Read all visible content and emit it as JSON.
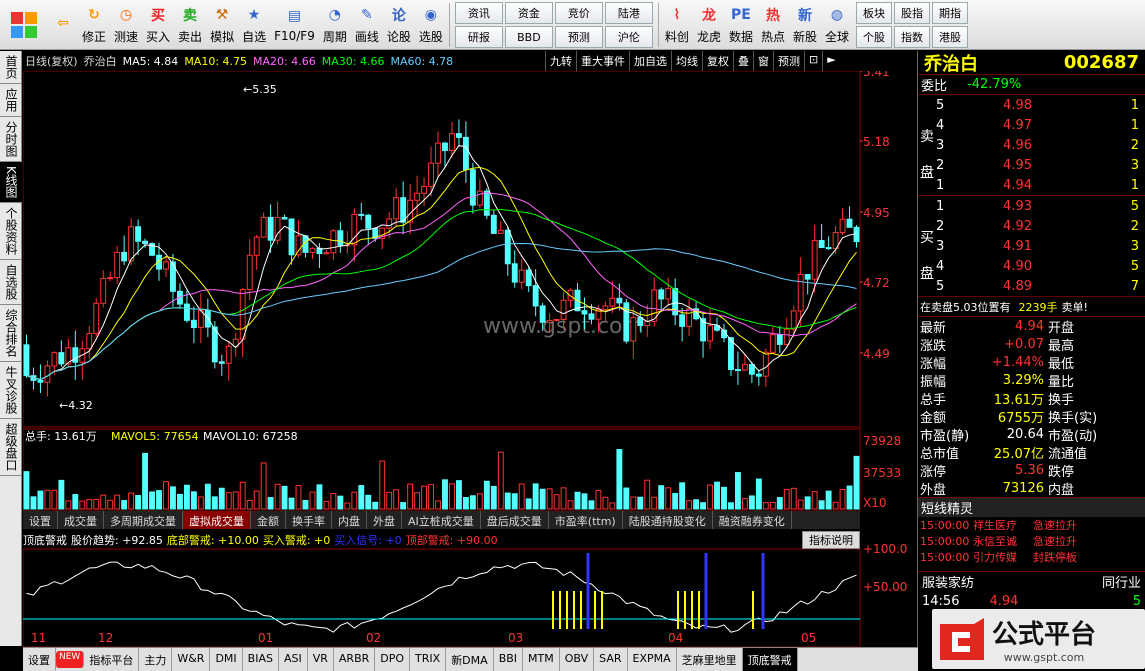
{
  "toolbar": {
    "buttons": [
      {
        "label": "",
        "icon": "back-arrow-icon"
      },
      {
        "label": "修正",
        "icon": "refresh-icon"
      },
      {
        "label": "测速",
        "icon": "clock-icon"
      },
      {
        "label": "买入",
        "icon": "buy-icon"
      },
      {
        "label": "卖出",
        "icon": "sell-icon"
      },
      {
        "label": "模拟",
        "icon": "hammer-icon"
      },
      {
        "label": "自选",
        "icon": "star-icon"
      },
      {
        "label": "F10/F9",
        "icon": "f10-icon"
      },
      {
        "label": "周期",
        "icon": "period-icon"
      },
      {
        "label": "画线",
        "icon": "pen-icon"
      },
      {
        "label": "论股",
        "icon": "chat-icon"
      },
      {
        "label": "选股",
        "icon": "select-icon"
      }
    ],
    "grid1": [
      "资讯",
      "资金",
      "竞价",
      "陆港",
      "研报",
      "BBD",
      "预测",
      "沪伦"
    ],
    "buttons2": [
      {
        "label": "料创",
        "icon": "chart-icon"
      },
      {
        "label": "龙虎",
        "icon": "dragon-icon"
      },
      {
        "label": "数据",
        "icon": "data-icon"
      },
      {
        "label": "热点",
        "icon": "hot-icon"
      },
      {
        "label": "新股",
        "icon": "newstock-icon"
      },
      {
        "label": "全球",
        "icon": "globe-icon"
      }
    ],
    "grid2": [
      "板块",
      "股指",
      "期指",
      "个股",
      "指数",
      "港股"
    ]
  },
  "left_tabs": [
    "首页",
    "应用",
    "分时图",
    "K线图",
    "个股资料",
    "自选股",
    "综合排名",
    "牛叉诊股",
    "超级盘口"
  ],
  "active_left_tab": "K线图",
  "kline_header": {
    "title": "日线(复权)",
    "stock": "乔治白",
    "ma": [
      {
        "label": "MA5: 4.84",
        "color": "#ffffff"
      },
      {
        "label": "MA10: 4.75",
        "color": "#ffff00"
      },
      {
        "label": "MA20: 4.66",
        "color": "#ff66ff"
      },
      {
        "label": "MA30: 4.66",
        "color": "#00ff00"
      },
      {
        "label": "MA60: 4.78",
        "color": "#66ccff"
      }
    ]
  },
  "kline_buttons": [
    "九转",
    "重大事件",
    "加自选",
    "均线",
    "复权",
    "叠",
    "窗",
    "预测"
  ],
  "price_axis": [
    "5.41",
    "5.18",
    "4.95",
    "4.72",
    "4.49"
  ],
  "annot_high": "5.35",
  "annot_low": "4.32",
  "vol_header": {
    "total": "总手: 13.61万",
    "mavol5": "MAVOL5: 77654",
    "mavol10": "MAVOL10: 67258"
  },
  "vol_axis": [
    "73928",
    "37533",
    "X10"
  ],
  "sub_tabs": [
    "设置",
    "成交量",
    "多周期成交量",
    "虚拟成交量",
    "金额",
    "换手率",
    "内盘",
    "外盘",
    "AI立桩成交量",
    "盘后成交量",
    "市盈率(ttm)",
    "陆股通持股变化",
    "融资融券变化"
  ],
  "active_sub_tab": "虚拟成交量",
  "ind_header": {
    "name": "顶底警戒",
    "trend": "股价趋势: +92.85",
    "bottom": "底部警戒: +10.00",
    "buy": "买入警戒: +0",
    "signal": "买入信号: +0",
    "top": "顶部警戒: +90.00",
    "btn": "指标说明"
  },
  "ind_axis": [
    "+100.0",
    "+50.00"
  ],
  "date_axis": [
    "11",
    "12",
    "01",
    "02",
    "03",
    "04",
    "05"
  ],
  "bottom_tabs": [
    "设置",
    "NEW",
    "指标平台",
    "主力",
    "W&R",
    "DMI",
    "BIAS",
    "ASI",
    "VR",
    "ARBR",
    "DPO",
    "TRIX",
    "新DMA",
    "BBI",
    "MTM",
    "OBV",
    "SAR",
    "EXPMA",
    "芝麻里地里",
    "顶底警戒"
  ],
  "active_bottom_tab": "顶底警戒",
  "right": {
    "name": "乔治白",
    "code": "002687",
    "weibi": "委比",
    "weibi_val": "-42.79%",
    "sell_label": "卖盘",
    "buy_label": "买盘",
    "sells": [
      {
        "n": "5",
        "p": "4.98",
        "v": "1"
      },
      {
        "n": "4",
        "p": "4.97",
        "v": "1"
      },
      {
        "n": "3",
        "p": "4.96",
        "v": "2"
      },
      {
        "n": "2",
        "p": "4.95",
        "v": "3"
      },
      {
        "n": "1",
        "p": "4.94",
        "v": "1"
      }
    ],
    "buys": [
      {
        "n": "1",
        "p": "4.93",
        "v": "5"
      },
      {
        "n": "2",
        "p": "4.92",
        "v": "2"
      },
      {
        "n": "3",
        "p": "4.91",
        "v": "3"
      },
      {
        "n": "4",
        "p": "4.90",
        "v": "5"
      },
      {
        "n": "5",
        "p": "4.89",
        "v": "7"
      }
    ],
    "position": "在卖盘5.03位置有",
    "pos_vol": "2239手",
    "pos_tag": "卖单!",
    "stats": [
      {
        "l": "最新",
        "v": "4.94",
        "l2": "开盘",
        "c": "red"
      },
      {
        "l": "涨跌",
        "v": "+0.07",
        "l2": "最高",
        "c": "red"
      },
      {
        "l": "涨幅",
        "v": "+1.44%",
        "l2": "最低",
        "c": "red"
      },
      {
        "l": "振幅",
        "v": "3.29%",
        "l2": "量比",
        "c": "yel"
      },
      {
        "l": "总手",
        "v": "13.61万",
        "l2": "换手",
        "c": "yel"
      },
      {
        "l": "金额",
        "v": "6755万",
        "l2": "换手(实)",
        "c": "yel"
      },
      {
        "l": "市盈(静)",
        "v": "20.64",
        "l2": "市盈(动)",
        "c": "wht"
      },
      {
        "l": "总市值",
        "v": "25.07亿",
        "l2": "流通值",
        "c": "yel"
      },
      {
        "l": "涨停",
        "v": "5.36",
        "l2": "跌停",
        "c": "red"
      },
      {
        "l": "外盘",
        "v": "73126",
        "l2": "内盘",
        "c": "yel"
      }
    ],
    "sprite_title": "短线精灵",
    "sprites": [
      {
        "t": "15:00:00",
        "n": "祥生医疗",
        "e": "急速拉升"
      },
      {
        "t": "15:00:00",
        "n": "永信至诚",
        "e": "急速拉升"
      },
      {
        "t": "15:00:00",
        "n": "引力传媒",
        "e": "封跌停板"
      }
    ],
    "sector": "服装家纺",
    "sector2": "同行业",
    "tick_time": "14:56",
    "tick_price": "4.94",
    "tick_vol": "5"
  },
  "footer_logo": {
    "text": "公式平台",
    "url": "www.gspt.com"
  },
  "watermark": "www.gspt.com"
}
